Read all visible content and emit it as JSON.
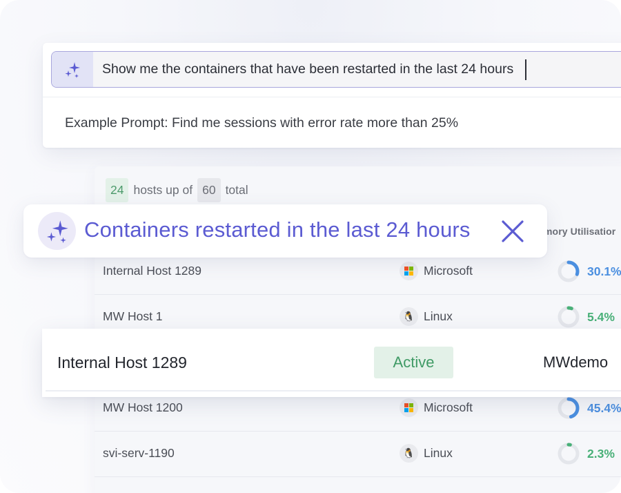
{
  "search": {
    "query": "Show me the containers that have been restarted in the last 24 hours",
    "example_prompt": "Example Prompt: Find me sessions with error rate more than 25%"
  },
  "hosts_summary": {
    "up_count": "24",
    "up_label": "hosts up of",
    "total_count": "60",
    "total_label": "total"
  },
  "table": {
    "memory_header": "mory Utilisatior",
    "rows_before": [
      {
        "host": "Internal Host 1289",
        "os": "Microsoft",
        "os_icon": "microsoft-icon",
        "memory": "30.1%",
        "memory_fraction": 0.301,
        "color": "#4b8fe0"
      },
      {
        "host": "MW Host 1",
        "os": "Linux",
        "os_icon": "linux-icon",
        "memory": "5.4%",
        "memory_fraction": 0.054,
        "color": "#49b078"
      }
    ],
    "rows_after": [
      {
        "host": "MW Host 1200",
        "os": "Microsoft",
        "os_icon": "microsoft-icon",
        "memory": "45.4%",
        "memory_fraction": 0.454,
        "color": "#4b8fe0"
      },
      {
        "host": "svi-serv-1190",
        "os": "Linux",
        "os_icon": "linux-icon",
        "memory": "2.3%",
        "memory_fraction": 0.023,
        "color": "#49b078"
      }
    ]
  },
  "filter": {
    "label": "Containers restarted in the last 24 hours",
    "icon": "sparkle-icon",
    "close_icon": "close-icon"
  },
  "highlight": {
    "host": "Internal Host 1289",
    "status": "Active",
    "environment": "MWdemo"
  },
  "colors": {
    "accent": "#5b5bd2",
    "active_bg": "#e3f1e8",
    "active_text": "#3f9a65"
  }
}
